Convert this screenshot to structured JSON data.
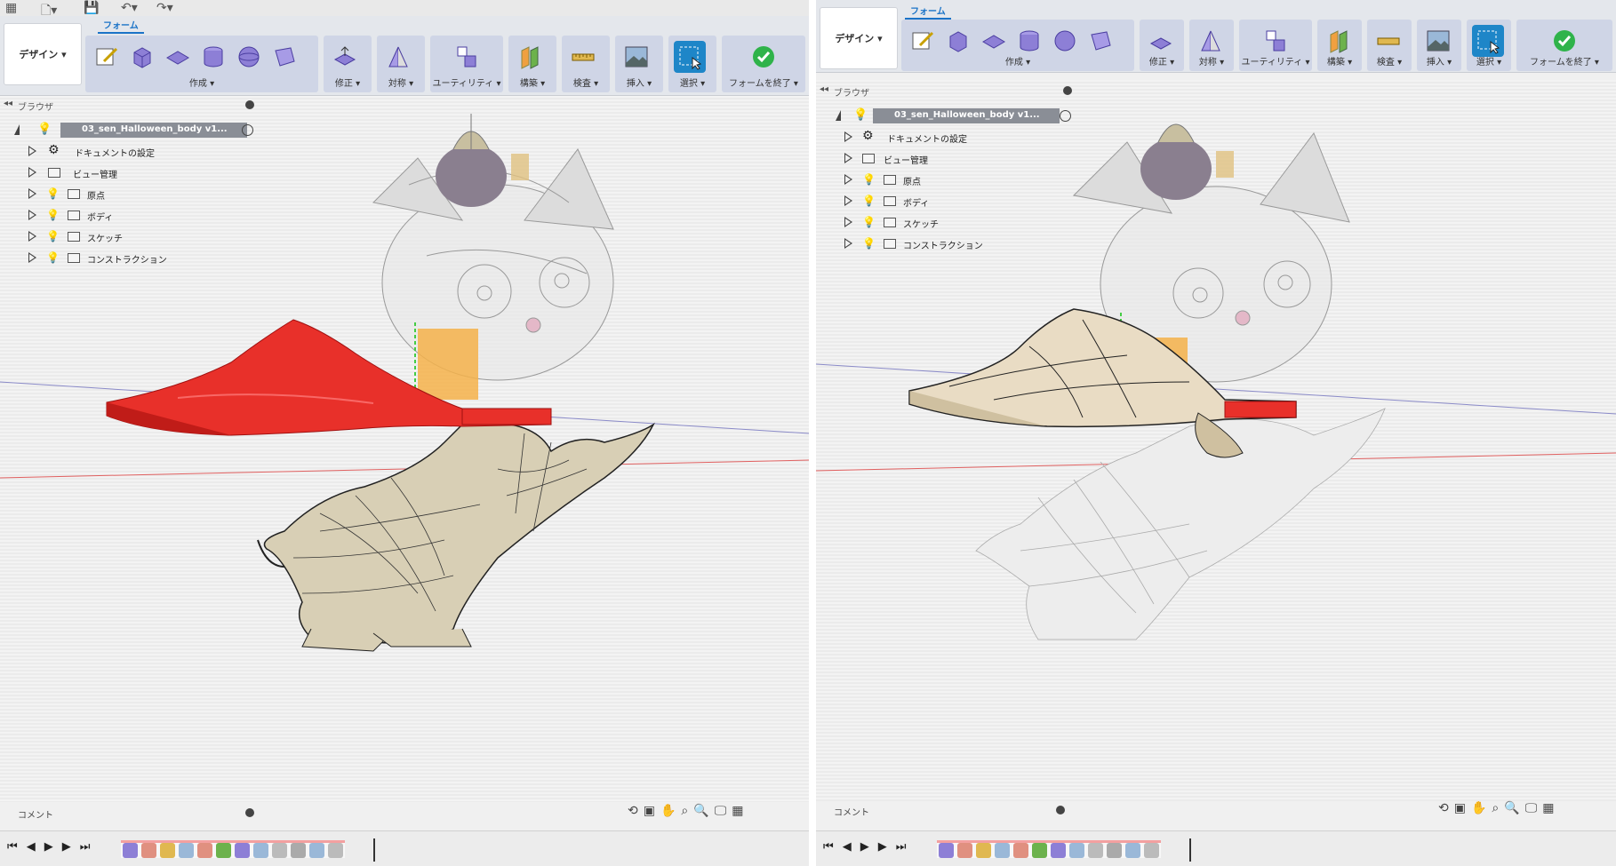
{
  "left": {
    "workspace_label": "デザイン ▾",
    "form_tab": "フォーム",
    "groups": [
      {
        "label": "作成 ▾"
      },
      {
        "label": "修正 ▾"
      },
      {
        "label": "対称 ▾"
      },
      {
        "label": "ユーティリティ ▾"
      },
      {
        "label": "構築 ▾"
      },
      {
        "label": "検査 ▾"
      },
      {
        "label": "挿入 ▾"
      },
      {
        "label": "選択 ▾"
      },
      {
        "label": "フォームを終了 ▾"
      }
    ],
    "browser_title": "ブラウザ",
    "root_label": "03_sen_Halloween_body v1...",
    "tree": [
      {
        "label": "ドキュメントの設定"
      },
      {
        "label": "ビュー管理"
      },
      {
        "label": "原点"
      },
      {
        "label": "ボディ"
      },
      {
        "label": "スケッチ"
      },
      {
        "label": "コンストラクション"
      }
    ],
    "comment_label": "コメント"
  },
  "right": {
    "workspace_label": "デザイン ▾",
    "form_tab": "フォーム",
    "groups": [
      {
        "label": "作成 ▾"
      },
      {
        "label": "修正 ▾"
      },
      {
        "label": "対称 ▾"
      },
      {
        "label": "ユーティリティ ▾"
      },
      {
        "label": "構築 ▾"
      },
      {
        "label": "検査 ▾"
      },
      {
        "label": "挿入 ▾"
      },
      {
        "label": "選択 ▾"
      },
      {
        "label": "フォームを終了 ▾"
      }
    ],
    "browser_title": "ブラウザ",
    "root_label": "03_sen_Halloween_body v1...",
    "tree": [
      {
        "label": "ドキュメントの設定"
      },
      {
        "label": "ビュー管理"
      },
      {
        "label": "原点"
      },
      {
        "label": "ボディ"
      },
      {
        "label": "スケッチ"
      },
      {
        "label": "コンストラクション"
      }
    ],
    "comment_label": "コメント"
  },
  "colors": {
    "toolbar_bg": "#e4e7ec",
    "group_bg": "#cfd5e6",
    "select_blue": "#1e86c8",
    "finish_green": "#2fb34a",
    "cape_red": "#e8302a",
    "cape_beige": "#e9dcc4",
    "body_beige": "#d8cfb5",
    "accent_orange": "#f4b24a"
  },
  "icons": {
    "quickbar": [
      "grid-icon",
      "file-icon",
      "save-icon",
      "undo-icon",
      "redo-icon"
    ],
    "tree": [
      "gear-icon",
      "folder-icon",
      "lightbulb-icon"
    ],
    "timeline": [
      "skip-start-icon",
      "step-back-icon",
      "play-icon",
      "step-forward-icon",
      "skip-end-icon"
    ]
  }
}
